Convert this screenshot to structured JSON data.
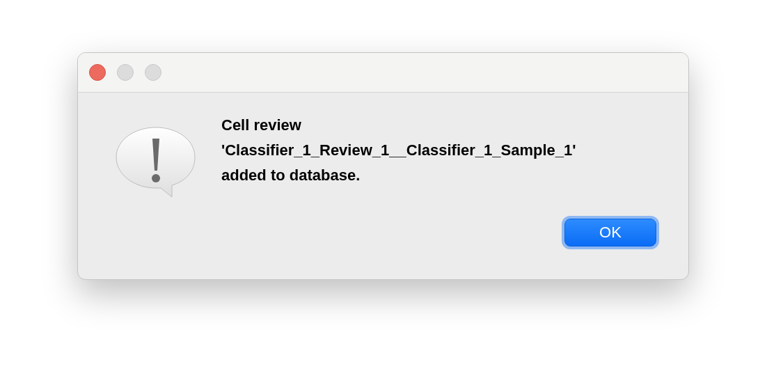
{
  "dialog": {
    "message_lines": [
      "Cell review",
      "'Classifier_1_Review_1__Classifier_1_Sample_1'",
      "added to database."
    ],
    "buttons": [
      {
        "label": "OK",
        "default": true
      }
    ]
  }
}
